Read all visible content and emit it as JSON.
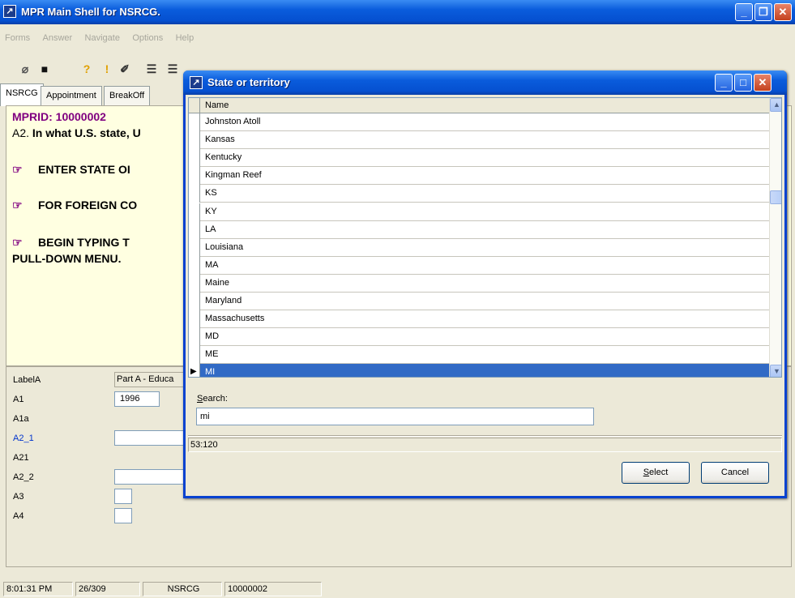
{
  "window": {
    "title": "MPR Main Shell for NSRCG."
  },
  "menu": [
    "Forms",
    "Answer",
    "Navigate",
    "Options",
    "Help"
  ],
  "toolbar_icons": [
    "eraser-icon",
    "save-icon",
    "help-icon",
    "alert-icon",
    "attach-icon",
    "doc-icon",
    "doc2-icon",
    "flag-icon",
    "flag2-icon",
    "flag3-icon",
    "flag4-icon",
    "list-icon",
    "tool-icon"
  ],
  "tabs": [
    "NSRCG",
    "Appointment",
    "BreakOff"
  ],
  "question": {
    "mprid": "MPRID: 10000002",
    "prefix": "A2.",
    "text": "In what U.S. state, U",
    "instr1": "ENTER STATE OI",
    "instr2": "FOR FOREIGN CO",
    "instr3_line1": "BEGIN TYPING T",
    "instr3_line2": "PULL-DOWN MENU."
  },
  "fields": [
    {
      "label": "LabelA",
      "value": "Part A - Educa",
      "box": true
    },
    {
      "label": "A1",
      "value": "1996",
      "box": true
    },
    {
      "label": "A1a",
      "value": "",
      "box": false
    },
    {
      "label": "A2_1",
      "value": "",
      "box": true
    },
    {
      "label": "A21",
      "value": "",
      "box": false
    },
    {
      "label": "A2_2",
      "value": "",
      "box": true
    },
    {
      "label": "A3",
      "value": "",
      "box": true
    },
    {
      "label": "A4",
      "value": "",
      "box": true
    }
  ],
  "status": {
    "time": "8:01:31 PM",
    "progress": "26/309",
    "survey": "NSRCG",
    "id": "10000002"
  },
  "dialog": {
    "title": "State or territory",
    "column": "Name",
    "items": [
      "Johnston Atoll",
      "Kansas",
      "Kentucky",
      "Kingman Reef",
      "KS",
      "KY",
      "LA",
      "Louisiana",
      "MA",
      "Maine",
      "Maryland",
      "Massachusetts",
      "MD",
      "ME",
      "MI"
    ],
    "selected": "MI",
    "search_label_accel": "S",
    "search_label_rest": "earch:",
    "search_value": "mi",
    "count": "53:120",
    "select_accel": "S",
    "select_rest": "elect",
    "cancel_label": "Cancel"
  },
  "colors": {
    "titlebar": "#0a5cdc",
    "question_bg": "#ffffe1",
    "mprid": "#800080",
    "selected_row": "#316ac5",
    "field_label_blue": "#0033cc"
  }
}
